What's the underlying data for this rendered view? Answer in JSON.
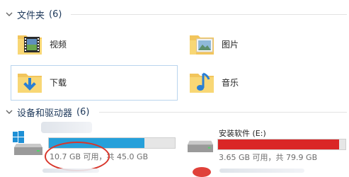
{
  "folders_section": {
    "title": "文件夹",
    "count": "(6)"
  },
  "folders": [
    {
      "label": "视频",
      "icon": "video-folder-icon"
    },
    {
      "label": "图片",
      "icon": "pictures-folder-icon"
    },
    {
      "label": "下载",
      "icon": "downloads-folder-icon"
    },
    {
      "label": "音乐",
      "icon": "music-folder-icon"
    }
  ],
  "devices_section": {
    "title": "设备和驱动器",
    "count": "(6)"
  },
  "drives": [
    {
      "name": "",
      "space": "10.7 GB 可用，共 45.0 GB",
      "used_fraction": 0.76,
      "bar_color": "#26a0da"
    },
    {
      "name": "安装软件 (E:)",
      "space": "3.65 GB 可用，共 79.9 GB",
      "used_fraction": 0.95,
      "bar_color": "#da2626"
    }
  ],
  "colors": {
    "accent_blue": "#26a0da",
    "warning_red": "#da2626",
    "annotation_red": "#d8352a",
    "header_text": "#1e395b"
  }
}
